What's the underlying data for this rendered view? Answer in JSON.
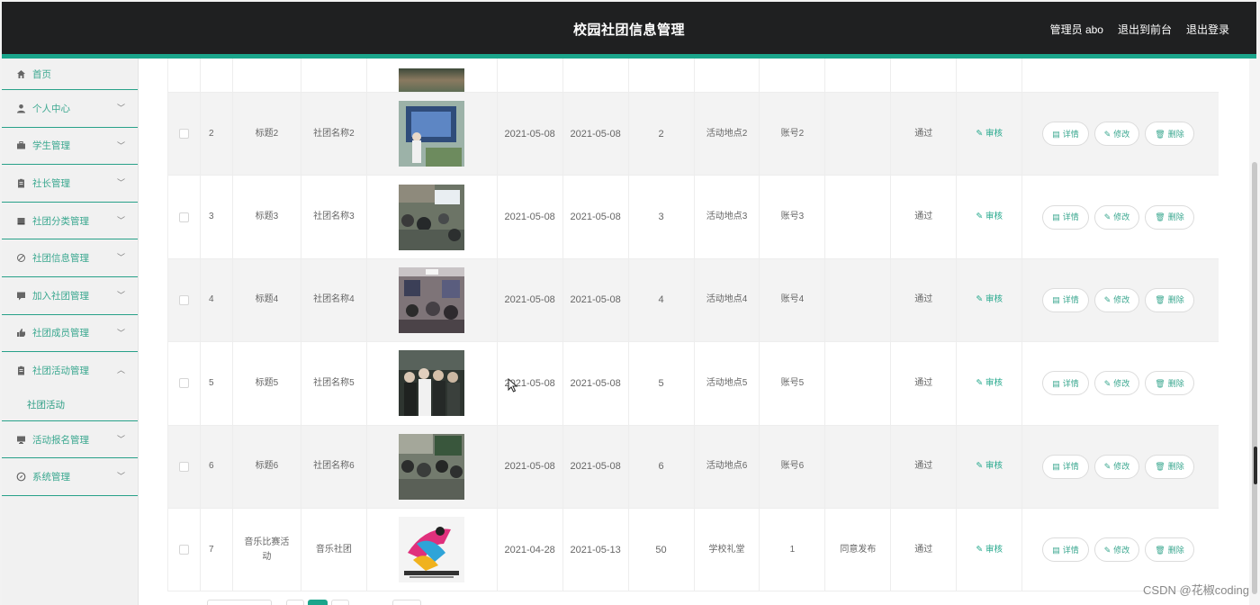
{
  "header": {
    "title": "校园社团信息管理",
    "admin_label": "管理员 abo",
    "to_front_label": "退出到前台",
    "logout_label": "退出登录"
  },
  "sidebar": {
    "items": [
      {
        "label": "首页",
        "icon": "home-icon"
      },
      {
        "label": "个人中心",
        "icon": "user-icon"
      },
      {
        "label": "学生管理",
        "icon": "briefcase-icon"
      },
      {
        "label": "社长管理",
        "icon": "clipboard-icon"
      },
      {
        "label": "社团分类管理",
        "icon": "folder-icon"
      },
      {
        "label": "社团信息管理",
        "icon": "disabled-icon"
      },
      {
        "label": "加入社团管理",
        "icon": "chat-icon"
      },
      {
        "label": "社团成员管理",
        "icon": "thumb-icon"
      },
      {
        "label": "社团活动管理",
        "icon": "clipboard-icon"
      },
      {
        "label": "活动报名管理",
        "icon": "monitor-icon"
      },
      {
        "label": "系统管理",
        "icon": "compass-icon"
      }
    ],
    "active_sub": "社团活动"
  },
  "table": {
    "rows": [
      {
        "idx": "2",
        "title": "标题2",
        "club": "社团名称2",
        "start": "2021-05-08",
        "end": "2021-05-08",
        "num": "2",
        "location": "活动地点2",
        "account": "账号2",
        "note": "",
        "status": "通过"
      },
      {
        "idx": "3",
        "title": "标题3",
        "club": "社团名称3",
        "start": "2021-05-08",
        "end": "2021-05-08",
        "num": "3",
        "location": "活动地点3",
        "account": "账号3",
        "note": "",
        "status": "通过"
      },
      {
        "idx": "4",
        "title": "标题4",
        "club": "社团名称4",
        "start": "2021-05-08",
        "end": "2021-05-08",
        "num": "4",
        "location": "活动地点4",
        "account": "账号4",
        "note": "",
        "status": "通过"
      },
      {
        "idx": "5",
        "title": "标题5",
        "club": "社团名称5",
        "start": "2021-05-08",
        "end": "2021-05-08",
        "num": "5",
        "location": "活动地点5",
        "account": "账号5",
        "note": "",
        "status": "通过"
      },
      {
        "idx": "6",
        "title": "标题6",
        "club": "社团名称6",
        "start": "2021-05-08",
        "end": "2021-05-08",
        "num": "6",
        "location": "活动地点6",
        "account": "账号6",
        "note": "",
        "status": "通过"
      },
      {
        "idx": "7",
        "title": "音乐比赛活动",
        "club": "音乐社团",
        "start": "2021-04-28",
        "end": "2021-05-13",
        "num": "50",
        "location": "学校礼堂",
        "account": "1",
        "note": "同意发布",
        "status": "通过"
      }
    ],
    "audit_label": "审核",
    "detail_label": "详情",
    "edit_label": "修改",
    "delete_label": "删除"
  },
  "watermark": "CSDN @花椒coding",
  "colors": {
    "header_bg": "#1f2021",
    "accent": "#1aa58b",
    "menu_text": "#3ba890"
  }
}
